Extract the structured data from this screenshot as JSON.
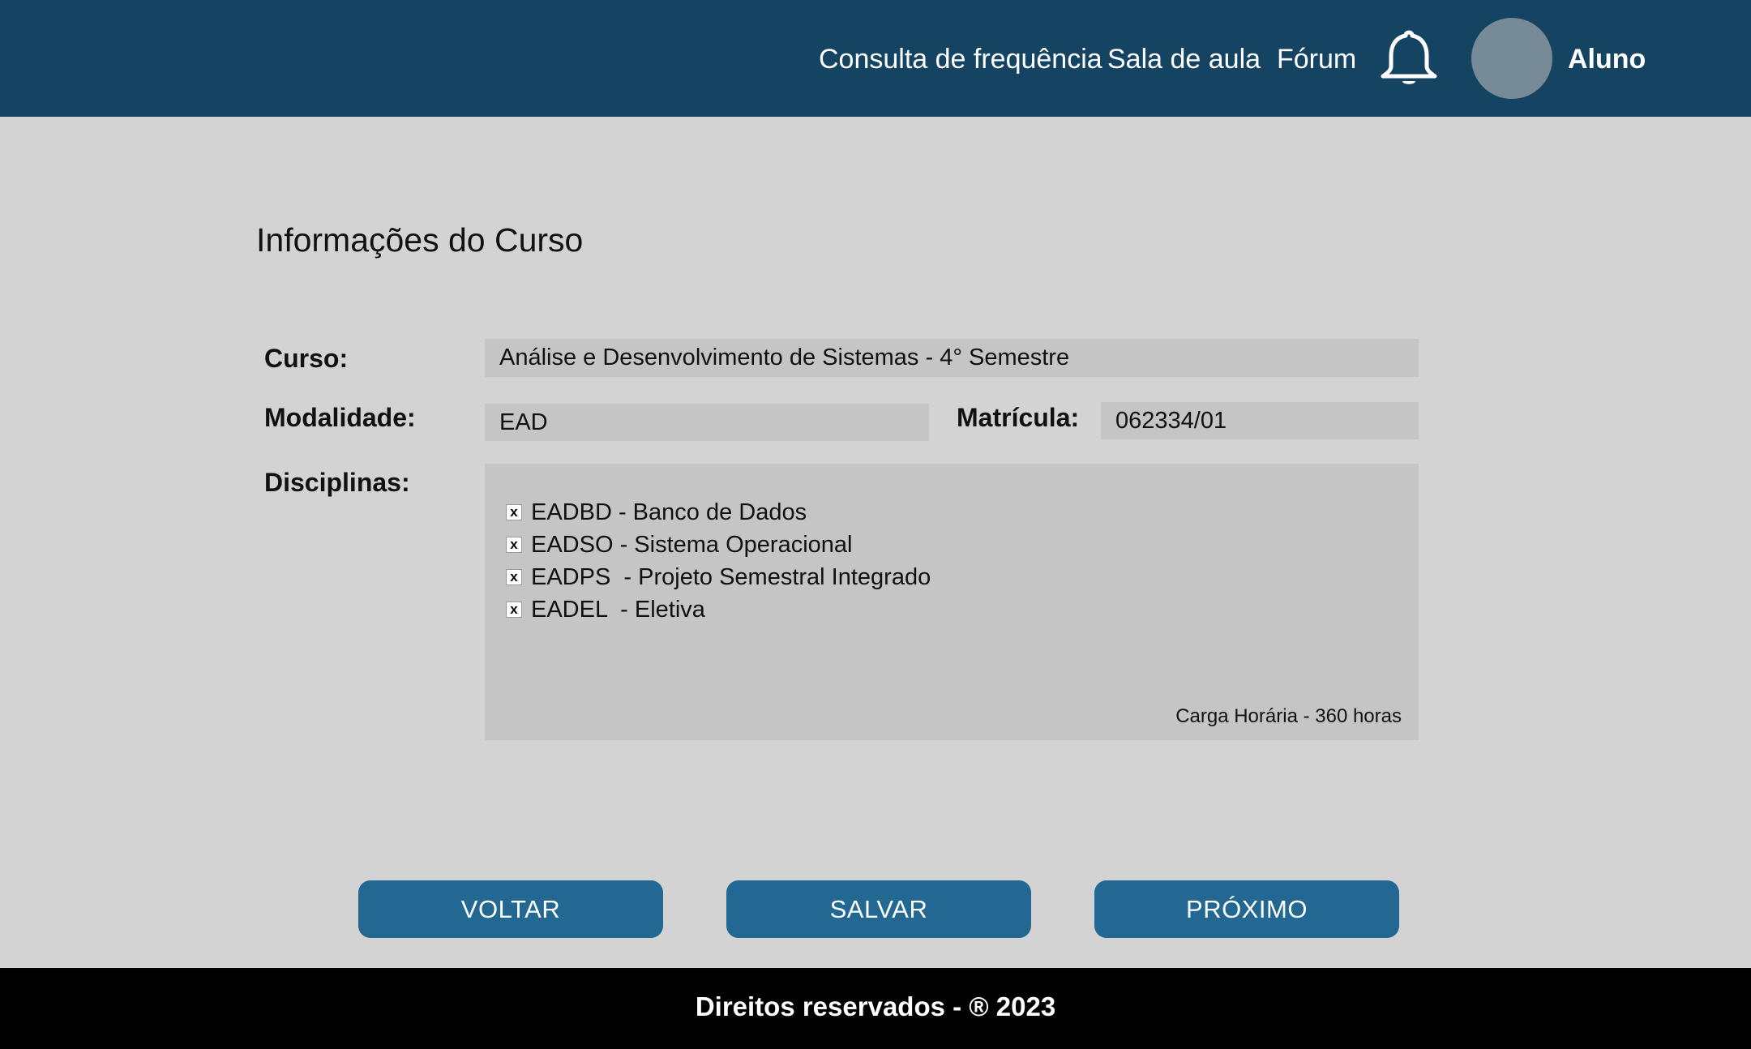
{
  "header": {
    "nav": [
      "Consulta de frequência",
      "Sala de aula",
      "Fórum"
    ],
    "bell_icon": "bell-icon",
    "user_name": "Aluno",
    "colors": {
      "background": "#154463",
      "avatar": "#778a98"
    }
  },
  "main": {
    "title": "Informações do Curso",
    "curso": {
      "label": "Curso:",
      "value": "Análise e Desenvolvimento de Sistemas - 4° Semestre"
    },
    "modalidade": {
      "label": "Modalidade:",
      "value": "EAD"
    },
    "matricula": {
      "label": "Matrícula:",
      "value": "062334/01"
    },
    "disciplinas": {
      "label": "Disciplinas:",
      "items": [
        {
          "text": "EADBD - Banco de Dados",
          "checked": true,
          "mark": "x"
        },
        {
          "text": "EADSO - Sistema Operacional",
          "checked": true,
          "mark": "x"
        },
        {
          "text": "EADPS  - Projeto Semestral Integrado",
          "checked": true,
          "mark": "x"
        },
        {
          "text": "EADEL  - Eletiva",
          "checked": true,
          "mark": "x"
        }
      ],
      "carga_horaria": "Carga Horária - 360 horas"
    }
  },
  "buttons": {
    "voltar": "VOLTAR",
    "salvar": "SALVAR",
    "proximo": "PRÓXIMO",
    "color": "#226893"
  },
  "footer": {
    "text": "Direitos reservados - ® 2023"
  }
}
